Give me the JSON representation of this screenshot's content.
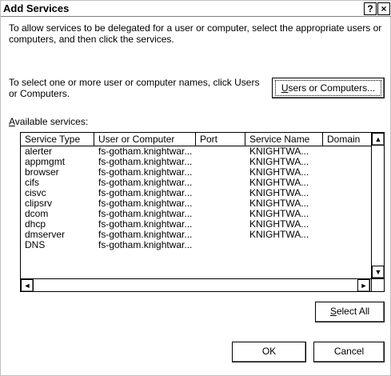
{
  "window": {
    "title": "Add Services",
    "help_glyph": "?",
    "close_glyph": "×"
  },
  "intro_text": "To allow services to be delegated for a user or computer, select the appropriate users or computers, and then click the services.",
  "select_text": "To select one or more user or computer names, click Users or Computers.",
  "users_button": {
    "mnemonic": "U",
    "rest": "sers or Computers..."
  },
  "available_label": {
    "mnemonic": "A",
    "rest": "vailable services:"
  },
  "columns": [
    "Service Type",
    "User or Computer",
    "Port",
    "Service Name",
    "Domain"
  ],
  "rows": [
    [
      "alerter",
      "fs-gotham.knightwar...",
      "",
      "KNIGHTWA...",
      ""
    ],
    [
      "appmgmt",
      "fs-gotham.knightwar...",
      "",
      "KNIGHTWA...",
      ""
    ],
    [
      "browser",
      "fs-gotham.knightwar...",
      "",
      "KNIGHTWA...",
      ""
    ],
    [
      "cifs",
      "fs-gotham.knightwar...",
      "",
      "KNIGHTWA...",
      ""
    ],
    [
      "cisvc",
      "fs-gotham.knightwar...",
      "",
      "KNIGHTWA...",
      ""
    ],
    [
      "clipsrv",
      "fs-gotham.knightwar...",
      "",
      "KNIGHTWA...",
      ""
    ],
    [
      "dcom",
      "fs-gotham.knightwar...",
      "",
      "KNIGHTWA...",
      ""
    ],
    [
      "dhcp",
      "fs-gotham.knightwar...",
      "",
      "KNIGHTWA...",
      ""
    ],
    [
      "dmserver",
      "fs-gotham.knightwar...",
      "",
      "KNIGHTWA...",
      ""
    ],
    [
      "DNS",
      "fs-gotham.knightwar...",
      "",
      "",
      ""
    ]
  ],
  "scroll_arrows": {
    "up": "▲",
    "down": "▼",
    "left": "◄",
    "right": "►"
  },
  "select_all_button": {
    "mnemonic": "S",
    "rest": "elect All"
  },
  "ok_button": "OK",
  "cancel_button": "Cancel",
  "colors": {
    "background": "#ffffff",
    "border": "#000000",
    "shadow": "#808080"
  },
  "icons": [
    "help-icon",
    "close-icon"
  ]
}
